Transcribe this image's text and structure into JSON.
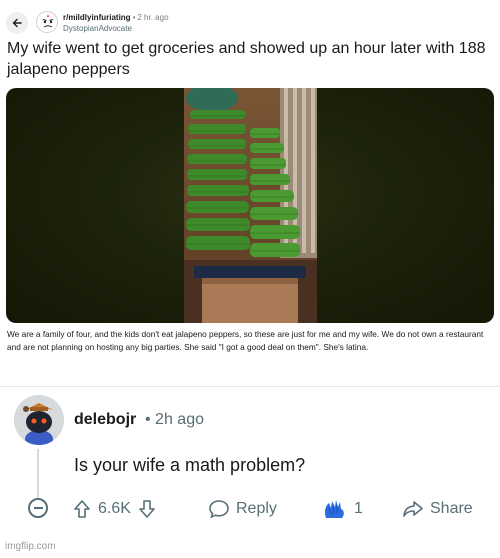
{
  "post": {
    "subreddit": "r/mildlyinfuriating",
    "time": "2 hr. ago",
    "username": "DystopianAdvocate",
    "title": "My wife went to get groceries and showed up an hour later with 188 jalapeno peppers",
    "body": "We are a family of four, and the kids don't eat jalapeno peppers, so these are just for me and my wife. We do not own a restaurant and are not planning on hosting any big parties. She said \"I got a good deal on them\". She's latina."
  },
  "comment": {
    "username": "delebojr",
    "time": "2h ago",
    "text": "Is your wife a math problem?",
    "votes": "6.6K",
    "reply_label": "Reply",
    "award_count": "1",
    "share_label": "Share"
  },
  "watermark": "imgflip.com",
  "icons": {
    "back": "arrow-left-icon",
    "upvote": "arrow-up-icon",
    "downvote": "arrow-down-icon",
    "reply": "speech-bubble-icon",
    "award": "hand-award-icon",
    "share": "share-arrow-icon",
    "collapse": "minus-circle-icon"
  },
  "colors": {
    "text": "#1a1a1b",
    "muted": "#576f76",
    "award": "#2a6de0"
  }
}
